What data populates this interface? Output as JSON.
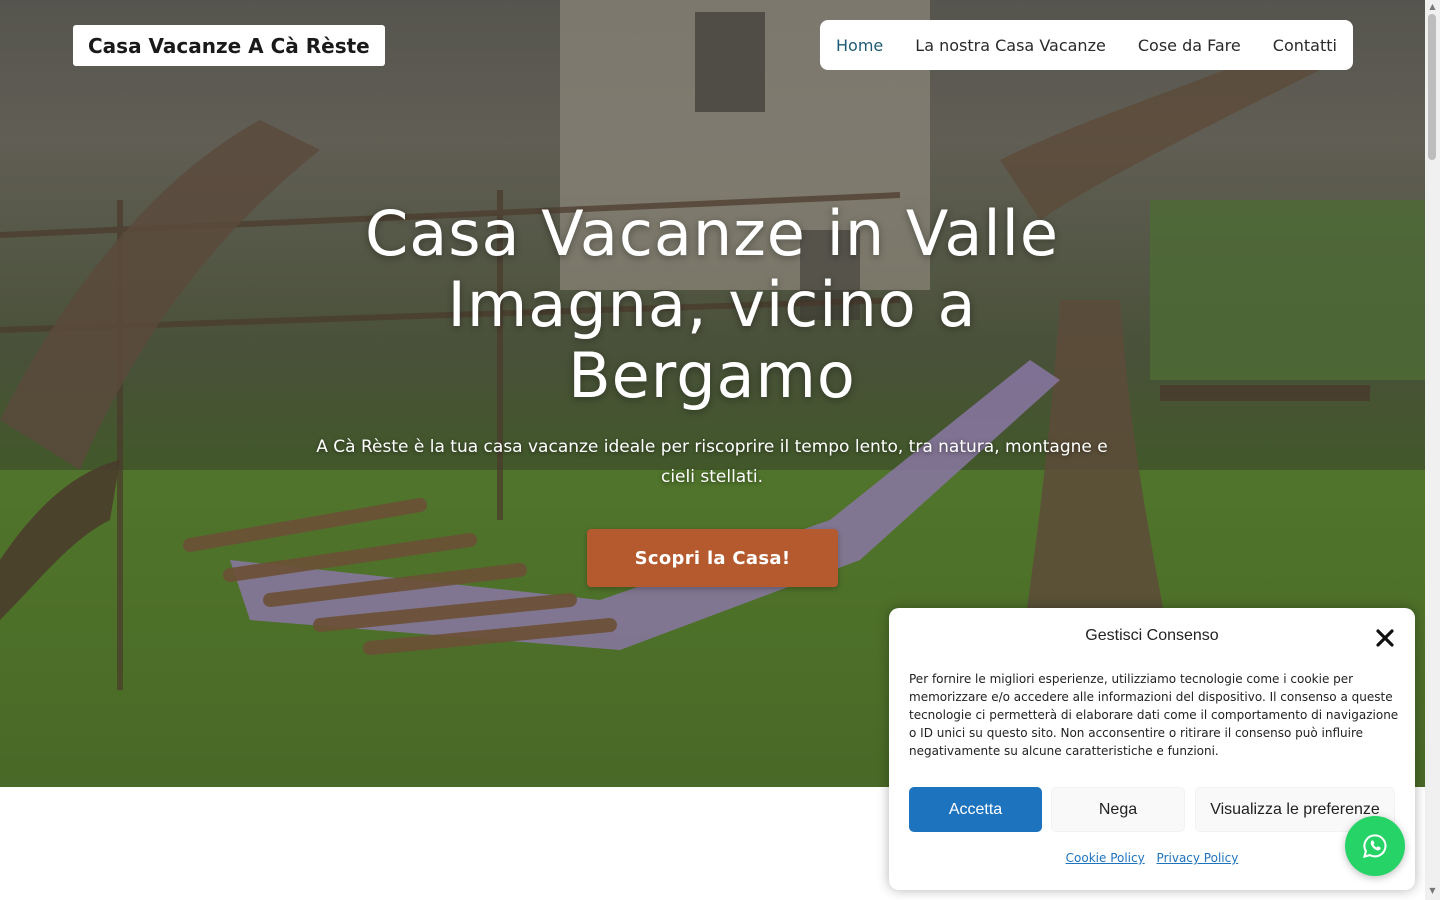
{
  "header": {
    "brand": "Casa Vacanze A Cà Rèste",
    "nav": [
      {
        "label": "Home",
        "active": true
      },
      {
        "label": "La nostra Casa Vacanze",
        "active": false
      },
      {
        "label": "Cose da Fare",
        "active": false
      },
      {
        "label": "Contatti",
        "active": false
      }
    ]
  },
  "hero": {
    "title": "Casa Vacanze in Valle Imagna, vicino a Bergamo",
    "subtitle": "A Cà Rèste è la tua casa vacanze ideale per riscoprire il tempo lento, tra natura, montagne e cieli stellati.",
    "cta_label": "Scopri la Casa!"
  },
  "cookie": {
    "title": "Gestisci Consenso",
    "body": "Per fornire le migliori esperienze, utilizziamo tecnologie come i cookie per memorizzare e/o accedere alle informazioni del dispositivo. Il consenso a queste tecnologie ci permetterà di elaborare dati come il comportamento di navigazione o ID unici su questo sito. Non acconsentire o ritirare il consenso può influire negativamente su alcune caratteristiche e funzioni.",
    "accept_label": "Accetta",
    "deny_label": "Nega",
    "prefs_label": "Visualizza le preferenze",
    "cookie_policy": "Cookie Policy",
    "privacy_policy": "Privacy Policy"
  },
  "colors": {
    "cta": "#b55a2f",
    "accept": "#1e73be",
    "whatsapp": "#25d366",
    "nav_active": "#1e5a74"
  },
  "icons": {
    "close": "close-icon",
    "whatsapp": "whatsapp-icon"
  }
}
